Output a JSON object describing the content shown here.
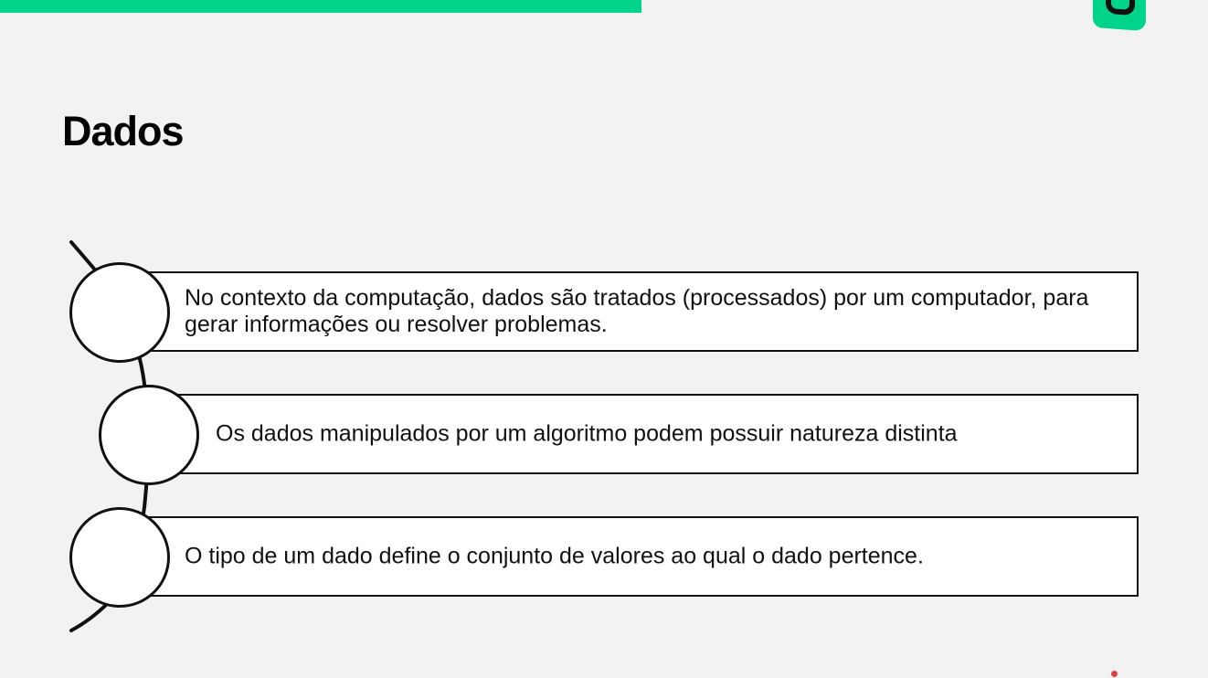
{
  "slide": {
    "title": "Dados",
    "accent_color": "#00d38a",
    "logo_icon": "brand-logo-icon",
    "items": [
      {
        "text": "No contexto da computação,  dados são tratados (processados) por um computador, para gerar informações ou resolver problemas."
      },
      {
        "text": "Os dados manipulados por um algoritmo podem possuir natureza distinta"
      },
      {
        "text": "O tipo de um dado define o conjunto de valores ao qual o dado pertence."
      }
    ]
  }
}
